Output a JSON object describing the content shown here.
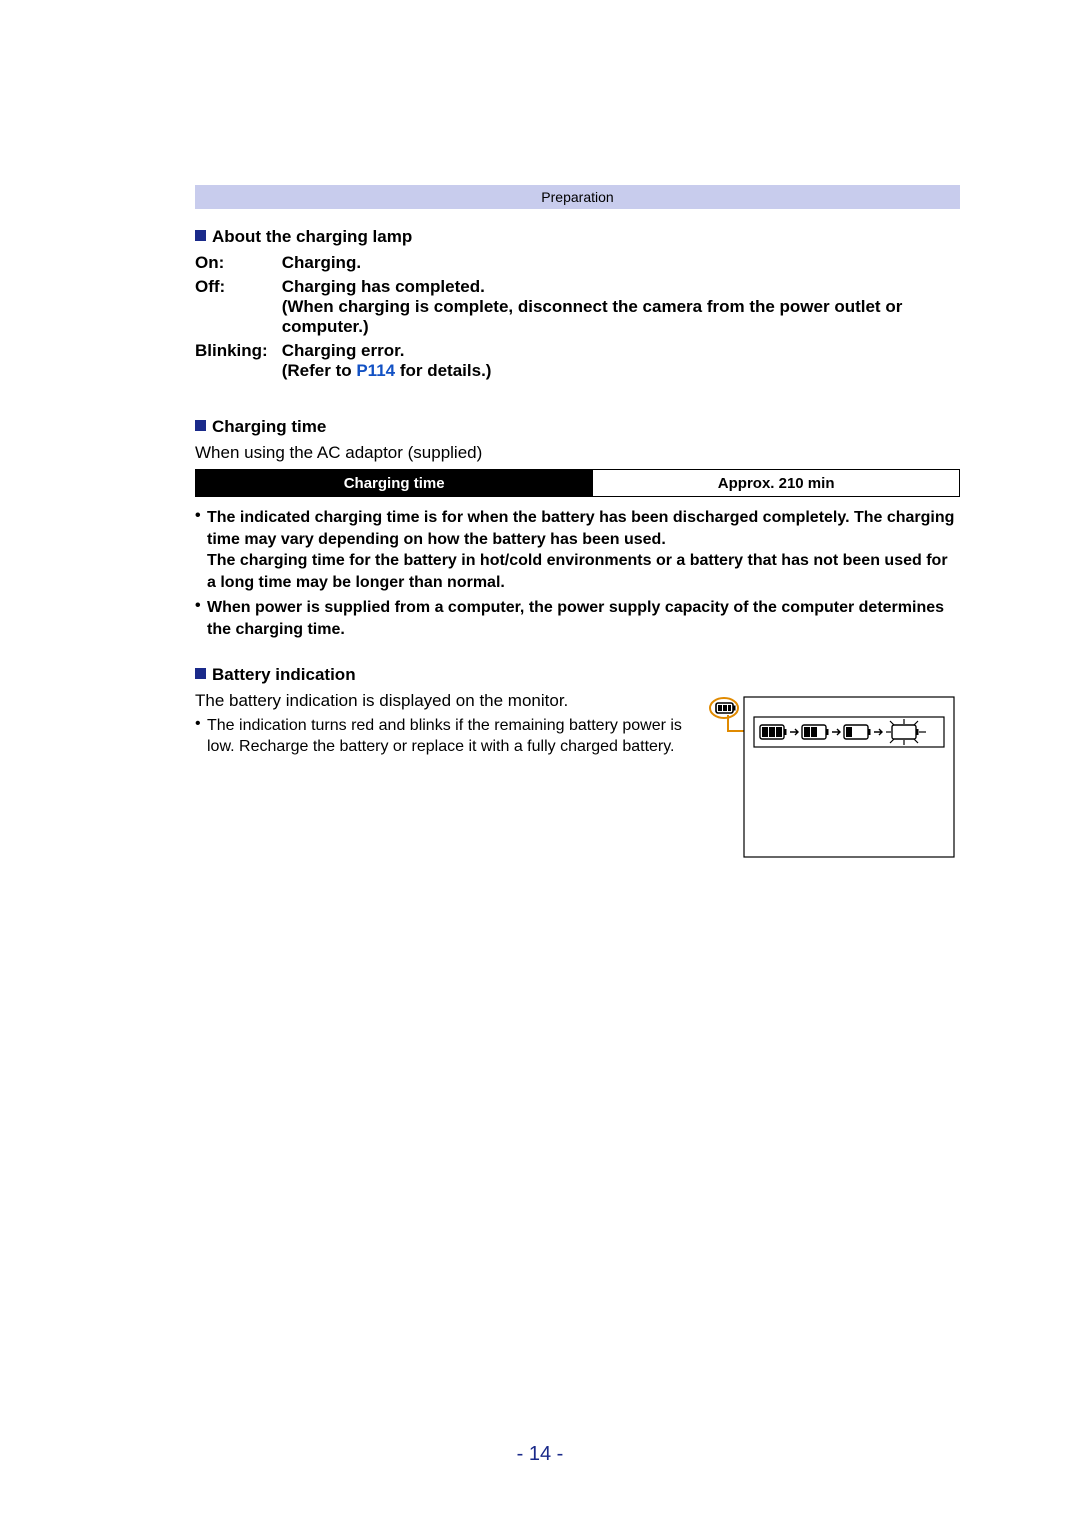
{
  "banner": {
    "title": "Preparation"
  },
  "section_lamp": {
    "heading": "About the charging lamp",
    "rows": [
      {
        "key": "On:",
        "val": "Charging."
      },
      {
        "key": "Off:",
        "val": "Charging has completed.\n(When charging is complete, disconnect the camera from the power outlet or computer.)"
      },
      {
        "key": "Blinking:",
        "val_pre": "Charging error.\n(Refer to ",
        "link": "P114",
        "val_post": " for details.)"
      }
    ]
  },
  "section_time": {
    "heading": "Charging time",
    "sub": "When using the AC adaptor (supplied)",
    "table": {
      "label": "Charging time",
      "value": "Approx. 210 min"
    },
    "bullets": [
      "The indicated charging time is for when the battery has been discharged completely. The charging time may vary depending on how the battery has been used.\nThe charging time for the battery in hot/cold environments or a battery that has not been used for a long time may be longer than normal.",
      "When power is supplied from a computer, the power supply capacity of the computer determines the charging time."
    ]
  },
  "section_batt": {
    "heading": "Battery indication",
    "text": "The battery indication is displayed on the monitor.",
    "bullet": "The indication turns red and blinks if the remaining battery power is low. Recharge the battery or replace it with a fully charged battery."
  },
  "page_number": "- 14 -",
  "chart_data": {
    "type": "table",
    "title": "Charging time",
    "categories": [
      "Charging time"
    ],
    "values": [
      "Approx. 210 min"
    ]
  }
}
